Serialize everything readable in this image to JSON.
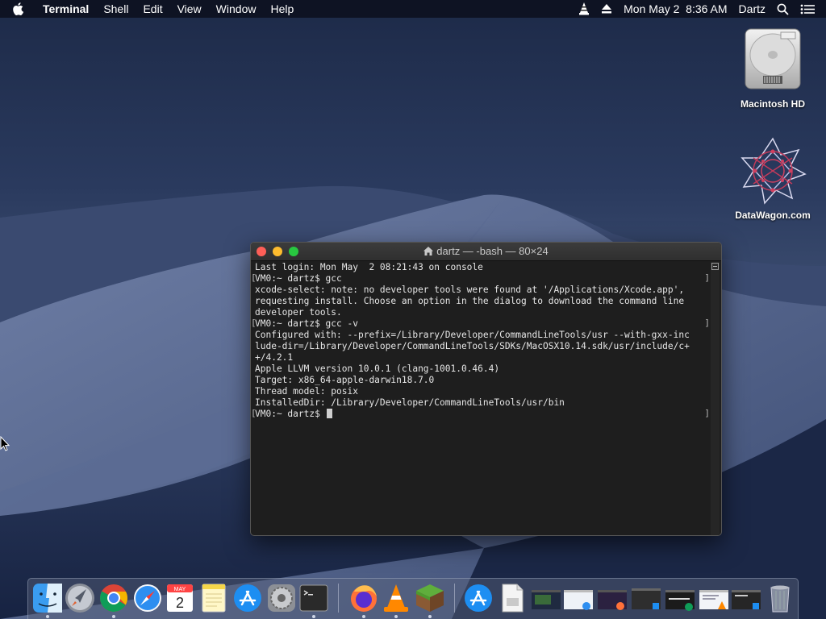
{
  "menubar": {
    "apple_icon": "apple-logo",
    "app_name": "Terminal",
    "menus": [
      "Shell",
      "Edit",
      "View",
      "Window",
      "Help"
    ],
    "time": "Mon May 2  8:36 AM",
    "user": "Dartz",
    "status_icons": [
      "vlc-icon",
      "eject-icon",
      "search-icon",
      "list-icon"
    ]
  },
  "desktop": {
    "icons": [
      {
        "label": "Macintosh HD",
        "icon": "hard-drive-icon"
      },
      {
        "label": "DataWagon.com",
        "icon": "datawagon-icon"
      }
    ]
  },
  "terminal": {
    "title": "dartz — -bash — 80×24",
    "lines": [
      "Last login: Mon May  2 08:21:43 on console",
      "VM0:~ dartz$ gcc",
      "xcode-select: note: no developer tools were found at '/Applications/Xcode.app',",
      "requesting install. Choose an option in the dialog to download the command line",
      "developer tools.",
      "VM0:~ dartz$ gcc -v",
      "Configured with: --prefix=/Library/Developer/CommandLineTools/usr --with-gxx-inc",
      "lude-dir=/Library/Developer/CommandLineTools/SDKs/MacOSX10.14.sdk/usr/include/c+",
      "+/4.2.1",
      "Apple LLVM version 10.0.1 (clang-1001.0.46.4)",
      "Target: x86_64-apple-darwin18.7.0",
      "Thread model: posix",
      "InstalledDir: /Library/Developer/CommandLineTools/usr/bin"
    ],
    "prompt": "VM0:~ dartz$ "
  },
  "dock": {
    "items": [
      {
        "name": "Finder",
        "running": true
      },
      {
        "name": "Launchpad",
        "running": false
      },
      {
        "name": "Google Chrome",
        "running": true
      },
      {
        "name": "Safari",
        "running": false
      },
      {
        "name": "Calendar",
        "running": false,
        "month": "MAY",
        "day": "2"
      },
      {
        "name": "Notes",
        "running": false
      },
      {
        "name": "App Store",
        "running": false
      },
      {
        "name": "System Preferences",
        "running": false
      },
      {
        "name": "Terminal",
        "running": true
      },
      {
        "name": "Firefox",
        "running": true
      },
      {
        "name": "VLC",
        "running": true
      },
      {
        "name": "Minecraft",
        "running": true
      },
      {
        "name": "App Store Downloads",
        "running": false
      },
      {
        "name": "Document",
        "running": false
      },
      {
        "name": "Minimized Window 1",
        "running": false
      },
      {
        "name": "Minimized Window 2",
        "running": false
      },
      {
        "name": "Minimized Window 3",
        "running": false
      },
      {
        "name": "Minimized Window 4",
        "running": false
      },
      {
        "name": "Minimized Window 5",
        "running": false
      },
      {
        "name": "Minimized Window 6",
        "running": false
      },
      {
        "name": "Minimized Window 7",
        "running": false
      },
      {
        "name": "Trash",
        "running": false
      }
    ]
  },
  "colors": {
    "close": "#fe5f57",
    "minimize": "#febc2e",
    "zoom": "#28c840",
    "terminal_bg": "#1e1e1e",
    "terminal_text": "#e6e6e6"
  }
}
